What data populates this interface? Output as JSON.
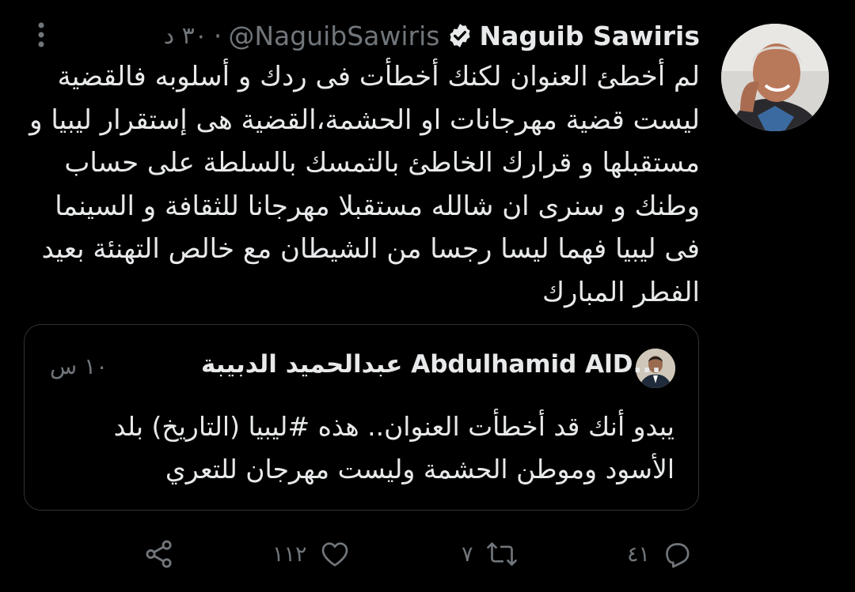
{
  "tweet": {
    "display_name": "Naguib Sawiris",
    "handle": "@NaguibSawiris",
    "separator": "·",
    "time": "٣٠ د",
    "verified": true,
    "text": "لم أخطئ العنوان لكنك أخطأت فى ردك و أسلوبه فالقضية ليست قضية مهرجانات او الحشمة،القضية هى إستقرار ليبيا و مستقبلها و قرارك الخاطئ بالتمسك بالسلطة على حساب وطنك و سنرى ان شالله مستقبلا مهرجانا للثقافة و السينما فى ليبيا فهما ليسا رجسا من الشيطان مع خالص التهنئة بعيد الفطر المبارك"
  },
  "quoted": {
    "display_name": "عبدالحميد الدبيبة Abdulhamid AlD...",
    "time": "١٠ س",
    "text": "يبدو أنك قد أخطأت العنوان.. هذه #ليبيا (التاريخ) بلد الأسود وموطن الحشمة وليست مهرجان للتعري"
  },
  "actions": {
    "replies": "٤١",
    "retweets": "٧",
    "likes": "١١٢"
  },
  "colors": {
    "background": "#000000",
    "text": "#e7e9ea",
    "muted": "#71767b",
    "border": "#2f3336"
  },
  "icons": [
    "more-icon",
    "verified-badge-icon",
    "reply-icon",
    "retweet-icon",
    "like-icon",
    "share-icon"
  ]
}
